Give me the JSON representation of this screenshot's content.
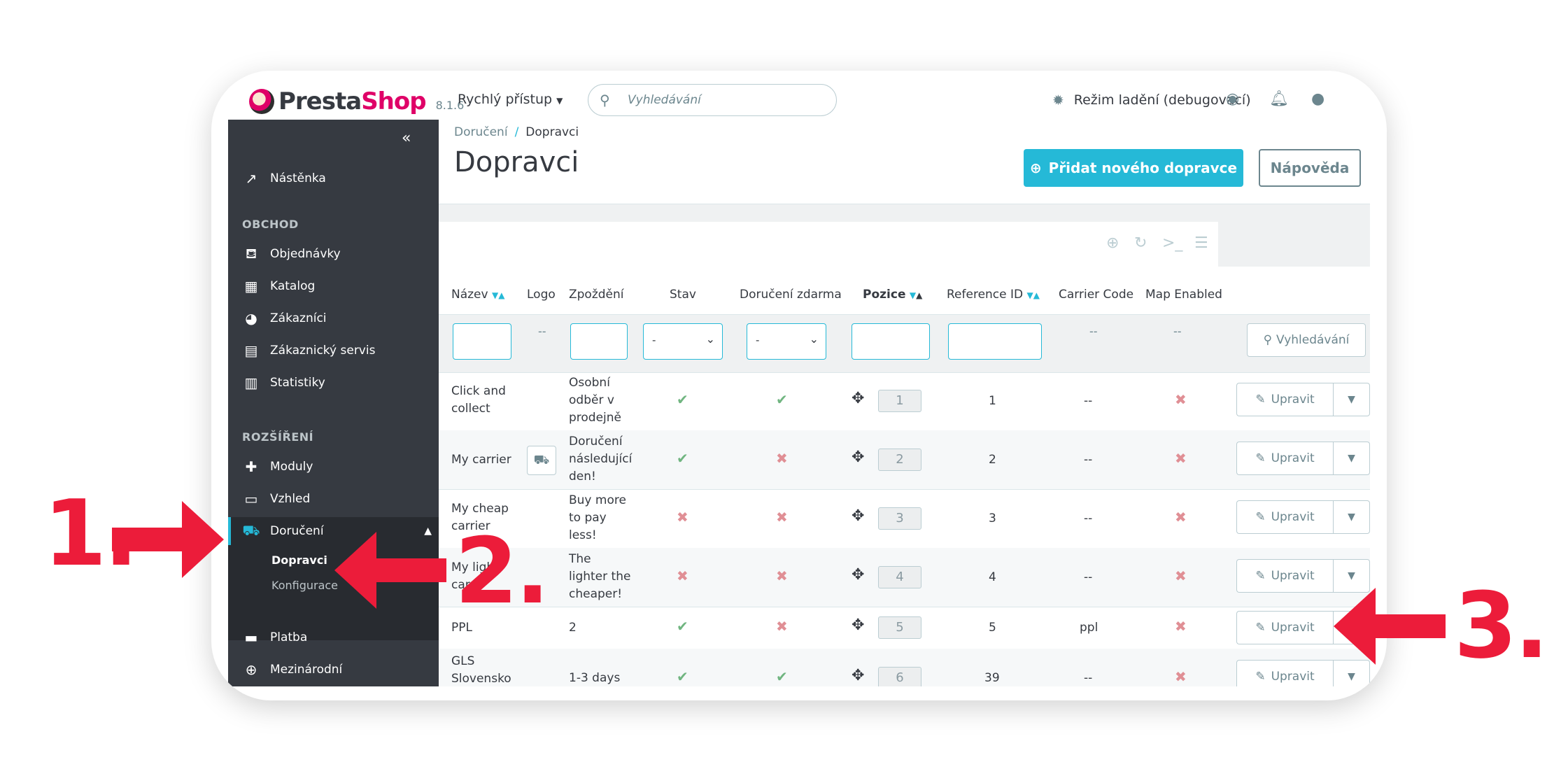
{
  "header": {
    "logo_text_a": "Presta",
    "logo_text_b": "Shop",
    "version": "8.1.6",
    "quick_access": "Rychlý přístup",
    "search_placeholder": "Vyhledávání",
    "debug_mode": "Režim ladění (debugovací)"
  },
  "sidebar": {
    "dashboard": "Nástěnka",
    "section_shop": "OBCHOD",
    "orders": "Objednávky",
    "catalog": "Katalog",
    "customers": "Zákazníci",
    "customer_service": "Zákaznický servis",
    "stats": "Statistiky",
    "section_ext": "ROZŠÍŘENÍ",
    "modules": "Moduly",
    "design": "Vzhled",
    "shipping": "Doručení",
    "carriers": "Dopravci",
    "config": "Konfigurace",
    "payment": "Platba",
    "international": "Mezinárodní"
  },
  "page": {
    "breadcrumb_parent": "Doručení",
    "breadcrumb_current": "Dopravci",
    "title": "Dopravci",
    "add_button": "Přidat nového dopravce",
    "help_button": "Nápověda"
  },
  "table": {
    "headers": {
      "name": "Název",
      "logo": "Logo",
      "delay": "Zpoždění",
      "status": "Stav",
      "free": "Doručení zdarma",
      "position": "Pozice",
      "ref": "Reference ID",
      "code": "Carrier Code",
      "map": "Map Enabled"
    },
    "filter": {
      "dash": "--",
      "select_dash": "-",
      "search_button": "Vyhledávání"
    },
    "edit_label": "Upravit",
    "rows": [
      {
        "name_a": "Click and",
        "name_b": "collect",
        "delay_a": "Osobní",
        "delay_b": "odběr v",
        "delay_c": "prodejně",
        "status": "yes",
        "free": "yes",
        "pos": "1",
        "ref": "1",
        "code": "--",
        "map": "no"
      },
      {
        "name_a": "My carrier",
        "name_b": "",
        "delay_a": "Doručení",
        "delay_b": "následující",
        "delay_c": "den!",
        "status": "yes",
        "free": "no",
        "pos": "2",
        "ref": "2",
        "code": "--",
        "map": "no"
      },
      {
        "name_a": "My cheap",
        "name_b": "carrier",
        "delay_a": "Buy more",
        "delay_b": "to pay",
        "delay_c": "less!",
        "status": "no",
        "free": "no",
        "pos": "3",
        "ref": "3",
        "code": "--",
        "map": "no"
      },
      {
        "name_a": "My ligh",
        "name_b": "carr",
        "delay_a": "The",
        "delay_b": "lighter the",
        "delay_c": "cheaper!",
        "status": "no",
        "free": "no",
        "pos": "4",
        "ref": "4",
        "code": "--",
        "map": "no"
      },
      {
        "name_a": "PPL",
        "name_b": "",
        "delay_a": "2",
        "delay_b": "",
        "delay_c": "",
        "status": "yes",
        "free": "no",
        "pos": "5",
        "ref": "5",
        "code": "ppl",
        "map": "no"
      },
      {
        "name_a": "GLS",
        "name_b": "Slovensko",
        "delay_a": "1-3 days",
        "delay_b": "",
        "delay_c": "",
        "status": "yes",
        "free": "yes",
        "pos": "6",
        "ref": "39",
        "code": "--",
        "map": "no"
      }
    ]
  },
  "annotations": {
    "step1": "1.",
    "step2": "2.",
    "step3": "3."
  },
  "colors": {
    "accent": "#25b9d7",
    "sidebar": "#363a41",
    "annotation": "#ec1c3a",
    "ok": "#70b580",
    "no": "#e08f95"
  }
}
